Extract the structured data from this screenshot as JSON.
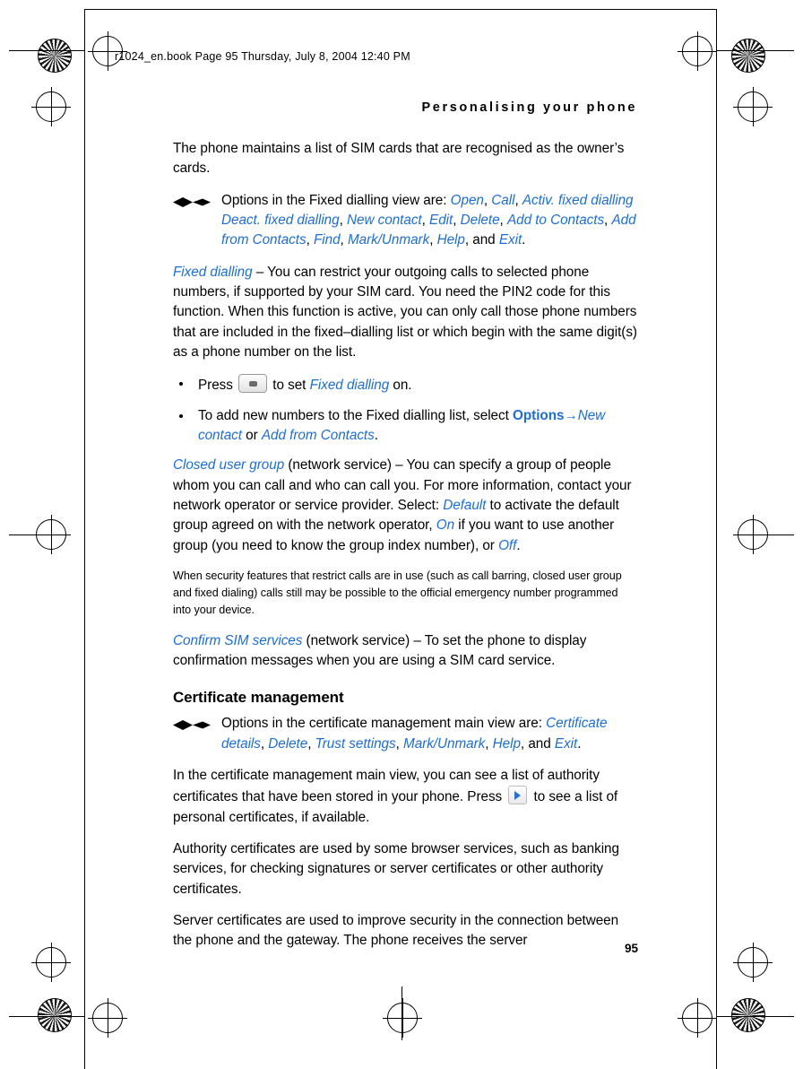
{
  "header": {
    "book_line": "r1024_en.book  Page 95  Thursday, July 8, 2004  12:40 PM",
    "chapter_title": "Personalising your phone"
  },
  "folio": "95",
  "content": {
    "p1": "The phone maintains a list of SIM cards that are recognised as the owner’s cards.",
    "options_fixed": {
      "lead": "Options in the Fixed dialling view are: ",
      "items": [
        "Open",
        "Call",
        "Activ. fixed dialling",
        "Deact. fixed dialling",
        "New contact",
        "Edit",
        "Delete",
        "Add to Contacts",
        "Add from Contacts",
        "Find",
        "Mark/Unmark",
        "Help",
        "Exit"
      ],
      "and": "and",
      "tail": "."
    },
    "fixed_dialling": {
      "term": "Fixed dialling",
      "body": " – You can restrict your outgoing calls to selected phone numbers, if supported by your SIM card. You need the PIN2 code for this function. When this function is active, you can only call those phone numbers that are included in the fixed–dialling list or which begin with the same digit(s) as a phone number on the list."
    },
    "bullet1": {
      "pre": "Press",
      "mid": "to set",
      "term": "Fixed dialling",
      "post": "on."
    },
    "bullet2": {
      "pre": "To add new numbers to the Fixed dialling list, select ",
      "options": "Options",
      "arrow": "→",
      "new_contact": "New contact",
      "or": " or ",
      "add_from_contacts": "Add from Contacts",
      "period": "."
    },
    "closed_user_group": {
      "term": "Closed user group",
      "body1": " (network service) – You can specify a group of people whom you can call and who can call you. For more information, contact your network operator or service provider. Select: ",
      "default": "Default",
      "body2": " to activate the default group agreed on with the network operator, ",
      "on": "On",
      "body3": " if you want to use another group (you need to know the group index number), or ",
      "off": "Off",
      "body4": "."
    },
    "security_note": "When security features that restrict calls are in use (such as call barring, closed user group and fixed dialing) calls still may be possible to the official emergency number programmed into your device.",
    "confirm_sim": {
      "term": "Confirm SIM services",
      "body": " (network service) – To set the phone to display confirmation messages when you are using a SIM card service."
    },
    "certificate_heading": "Certificate management",
    "options_cert": {
      "lead": "Options in the certificate management main view are: ",
      "items": [
        "Certificate details",
        "Delete",
        "Trust settings",
        "Mark/Unmark",
        "Help",
        "Exit"
      ],
      "and": "and",
      "tail": "."
    },
    "cert_p1": {
      "pre": "In the certificate management main view, you can see a list of authority certificates that have been stored in your phone. Press",
      "post": "to see a list of personal certificates, if available."
    },
    "cert_p2": "Authority certificates are used by some browser services, such as banking services, for checking signatures or server certificates or other authority certificates.",
    "cert_p3": "Server certificates are used to improve security in the connection between the phone and the gateway. The phone receives the server"
  },
  "icons": {
    "options_glyph": "options-diamond-icon",
    "scroll_key": "scroll-key-icon",
    "right_key": "right-arrow-key-icon"
  },
  "colors": {
    "link_blue": "#1d6ed4",
    "key_arrow_blue": "#2f6fd0"
  }
}
